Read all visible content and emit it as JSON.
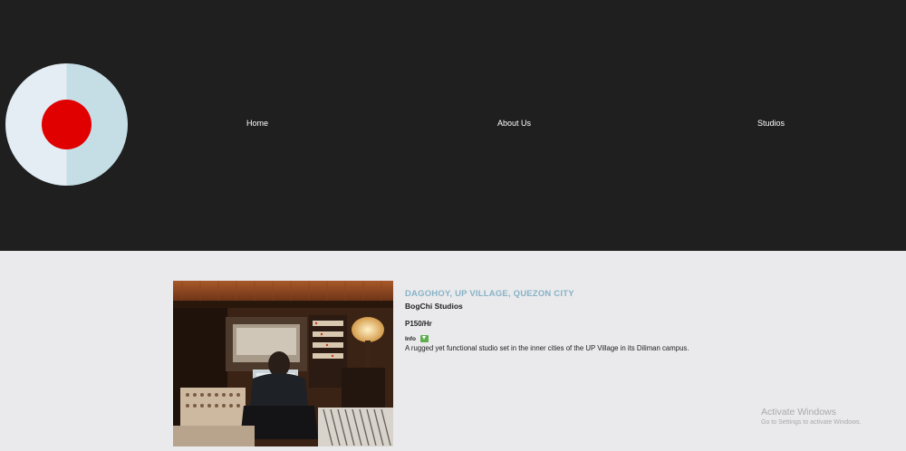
{
  "nav": {
    "items": [
      {
        "label": "Home"
      },
      {
        "label": "About Us"
      },
      {
        "label": "Studios"
      }
    ]
  },
  "studio": {
    "location": "DAGOHOY, UP VILLAGE, QUEZON CITY",
    "name": "BogChi Studios",
    "price": "P150/Hr",
    "info_label": "Info",
    "description": "A rugged yet functional studio set in the inner cities of the UP Village in its Diliman campus."
  },
  "watermark": {
    "title": "Activate Windows",
    "subtitle": "Go to Settings to activate Windows."
  },
  "colors": {
    "header_bg": "#1f1f1f",
    "content_bg": "#eaeaec",
    "logo_red": "#e00000",
    "location_accent": "#86b3c7",
    "info_icon": "#5fae4f"
  }
}
